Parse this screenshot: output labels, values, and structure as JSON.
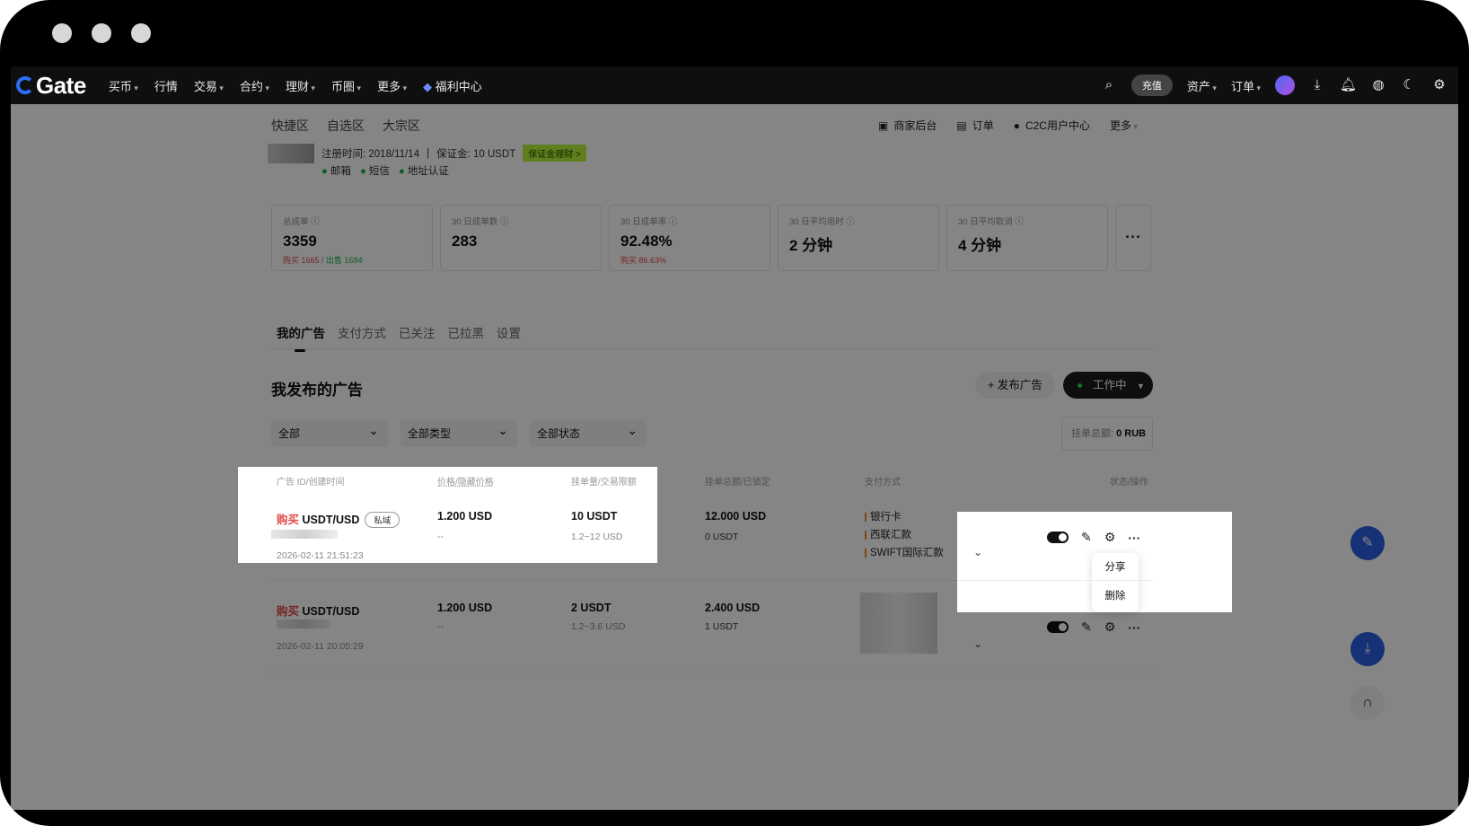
{
  "nav": {
    "logo": "Gate",
    "items": [
      "买币",
      "行情",
      "交易",
      "合约",
      "理财",
      "币圈",
      "更多"
    ],
    "welfare": "福利中心",
    "recharge": "充值",
    "assets": "资产",
    "orders": "订单"
  },
  "subnav": {
    "left": [
      "快捷区",
      "自选区",
      "大宗区"
    ],
    "merchant_backend": "商家后台",
    "orders": "订单",
    "c2c_center": "C2C用户中心",
    "more": "更多"
  },
  "profile": {
    "reg_time": "注册时间: 2018/11/14",
    "deposit": "保证金: 10 USDT",
    "deposit_tag": "保证金理财 >",
    "verifications": [
      "邮箱",
      "短信",
      "地址认证"
    ]
  },
  "stats": [
    {
      "label": "总成单",
      "value": "3359",
      "sub_red": "购买 1665",
      "sub_sep": " / ",
      "sub_green": "出售 1694"
    },
    {
      "label": "30 日成单数",
      "value": "283",
      "sub_red": "",
      "sub_sep": "",
      "sub_green": ""
    },
    {
      "label": "30 日成单率",
      "value": "92.48%",
      "sub_red": "购买 86.63%",
      "sub_sep": "",
      "sub_green": ""
    },
    {
      "label": "30 日平均用时",
      "value": "2 分钟",
      "sub_red": "",
      "sub_sep": "",
      "sub_green": ""
    },
    {
      "label": "30 日平均取消",
      "value": "4 分钟",
      "sub_red": "",
      "sub_sep": "",
      "sub_green": ""
    }
  ],
  "stats_more": "···",
  "tabs": [
    "我的广告",
    "支付方式",
    "已关注",
    "已拉黑",
    "设置"
  ],
  "section": {
    "title": "我发布的广告",
    "publish_btn": "+ 发布广告",
    "status_btn": "工作中"
  },
  "filters": [
    "全部",
    "全部类型",
    "全部状态"
  ],
  "total": {
    "label": "挂单总额: ",
    "value": "0 RUB"
  },
  "table": {
    "headers": [
      "广告 ID/创建时间",
      "价格/隐藏价格",
      "挂单量/交易限额",
      "挂单总额/已锁定",
      "支付方式",
      "状态/操作"
    ],
    "rows": [
      {
        "side": "购买",
        "pair": " USDT/USD",
        "badge": "私域",
        "created": "2026-02-11 21:51:23",
        "price": "1.200 USD",
        "hidden_price": "--",
        "amount": "10 USDT",
        "limit": "1.2~12 USD",
        "total": "12.000 USD",
        "locked": "0 USDT",
        "payments": [
          "银行卡",
          "西联汇款",
          "SWIFT国际汇款"
        ]
      },
      {
        "side": "购买",
        "pair": " USDT/USD",
        "badge": "",
        "created": "2026-02-11 20:05:29",
        "price": "1.200 USD",
        "hidden_price": "--",
        "amount": "2 USDT",
        "limit": "1.2~3.6 USD",
        "total": "2.400 USD",
        "locked": "1 USDT",
        "payments": []
      }
    ]
  },
  "more_menu": [
    "分享",
    "删除"
  ],
  "colors": {
    "accent": "#2b5fe0",
    "buy": "#e24a4a",
    "green": "#1fb14a"
  }
}
